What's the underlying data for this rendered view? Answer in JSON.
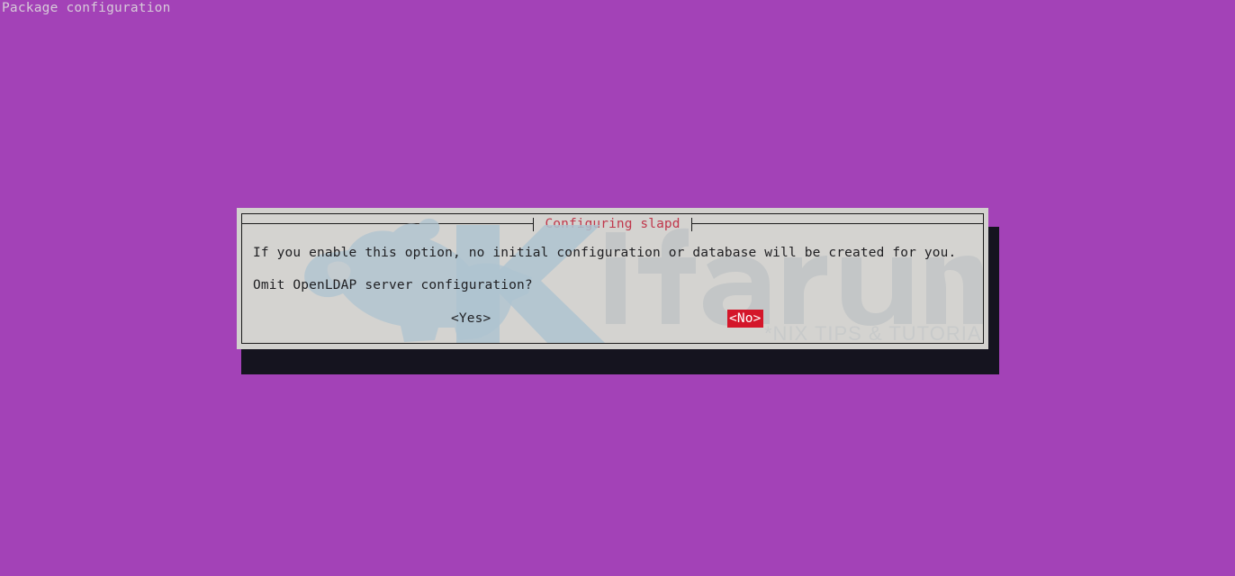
{
  "screen": {
    "heading": "Package configuration",
    "background_color": "#a342b7",
    "heading_color": "#d7cbd9"
  },
  "dialog": {
    "title": "Configuring slapd",
    "title_color": "#c0374b",
    "background_color": "#d2d1ce",
    "border_color": "#1b1b1b",
    "shadow_color": "#15141f",
    "text_lines": [
      "If you enable this option, no initial configuration or database will be created for you.",
      "Omit OpenLDAP server configuration?"
    ],
    "buttons": [
      {
        "label": "<Yes>",
        "selected": false,
        "text_color": "#1f1f22",
        "background_color": "transparent"
      },
      {
        "label": "<No>",
        "selected": true,
        "text_color": "#ffffff",
        "background_color": "#d4162a"
      }
    ]
  },
  "watermark": {
    "brand": "ifarunix",
    "initial": "K",
    "tagline": "*NIX TIPS & TUTORIALS",
    "mark_color": "#aec3d0",
    "text_color": "#c0c4c5"
  }
}
